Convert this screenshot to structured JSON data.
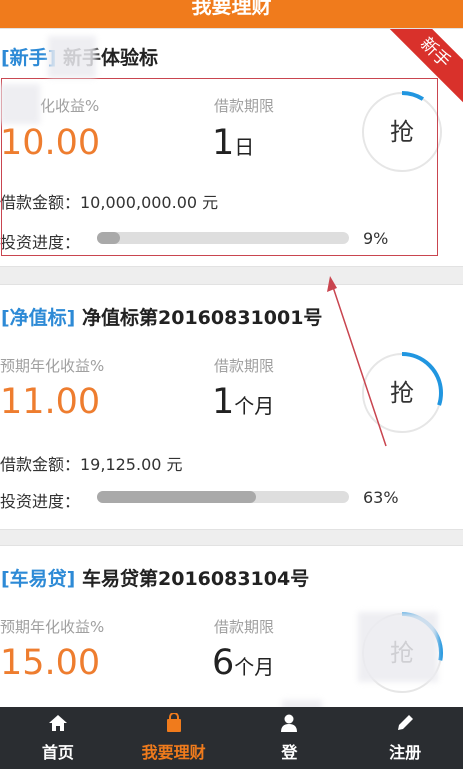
{
  "header": {
    "title": "我要理财"
  },
  "loans": [
    {
      "tag": "[新手",
      "tag_end": "]",
      "name": "新手体验标",
      "rate_label": "化收益%",
      "rate": "10.00",
      "term_label": "借款期限",
      "term_value": "1",
      "term_unit": "日",
      "amount_line": "借款金额：10,000,000.00 元",
      "progress_label": "投资进度：",
      "progress": 9,
      "progress_text": "9%",
      "button": "抢",
      "badge": "新手"
    },
    {
      "tag": "[净值标]",
      "name": "净值标第20160831001号",
      "rate_label": "预期年化收益%",
      "rate": "11.00",
      "term_label": "借款期限",
      "term_value": "1",
      "term_unit": "个月",
      "amount_line": "借款金额：19,125.00 元",
      "progress_label": "投资进度：",
      "progress": 63,
      "progress_text": "63%",
      "button": "抢"
    },
    {
      "tag": "[车易贷]",
      "name": "车易贷第2016083104号",
      "rate_label": "预期年化收益%",
      "rate": "15.00",
      "term_label": "借款期限",
      "term_value": "6",
      "term_unit": "个月",
      "button": "抢"
    }
  ],
  "tabs": [
    {
      "label": "首页",
      "icon": "home-icon"
    },
    {
      "label": "我要理财",
      "icon": "bag-icon",
      "active": true
    },
    {
      "label": "登",
      "icon": "user-icon"
    },
    {
      "label": "注册",
      "icon": "pencil-icon"
    }
  ],
  "colors": {
    "accent": "#f07b1c",
    "tag": "#2d8ad6",
    "badge": "#d9312b",
    "tabbar": "#2a2d31"
  }
}
